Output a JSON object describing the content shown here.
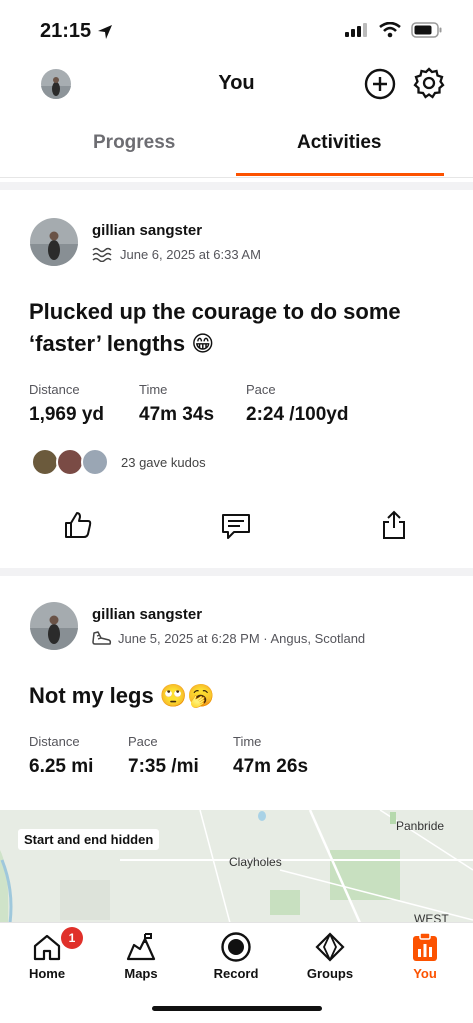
{
  "status": {
    "time": "21:15"
  },
  "header": {
    "title": "You"
  },
  "tabs": [
    {
      "label": "Progress"
    },
    {
      "label": "Activities"
    }
  ],
  "activities": [
    {
      "athlete": "gillian sangster",
      "sport_icon": "swim-icon",
      "datetime": "June 6, 2025 at 6:33 AM",
      "title": "Plucked up the courage to do some ‘faster’ lengths 😁",
      "stats": [
        {
          "label": "Distance",
          "value": "1,969 yd"
        },
        {
          "label": "Time",
          "value": "47m 34s"
        },
        {
          "label": "Pace",
          "value": "2:24 /100yd"
        }
      ],
      "kudos_text": "23 gave kudos"
    },
    {
      "athlete": "gillian sangster",
      "sport_icon": "run-shoe-icon",
      "datetime": "June 5, 2025 at 6:28 PM · Angus, Scotland",
      "title": "Not my legs 🙄🥱",
      "stats": [
        {
          "label": "Distance",
          "value": "6.25 mi"
        },
        {
          "label": "Pace",
          "value": "7:35 /mi"
        },
        {
          "label": "Time",
          "value": "47m 26s"
        }
      ],
      "map": {
        "hidden_label": "Start and end hidden",
        "places": [
          "Panbride",
          "Clayholes",
          "WEST"
        ]
      }
    }
  ],
  "bottom_nav": [
    {
      "label": "Home",
      "badge": "1"
    },
    {
      "label": "Maps"
    },
    {
      "label": "Record"
    },
    {
      "label": "Groups"
    },
    {
      "label": "You"
    }
  ],
  "colors": {
    "accent": "#fc5200",
    "badge": "#e0302a"
  }
}
